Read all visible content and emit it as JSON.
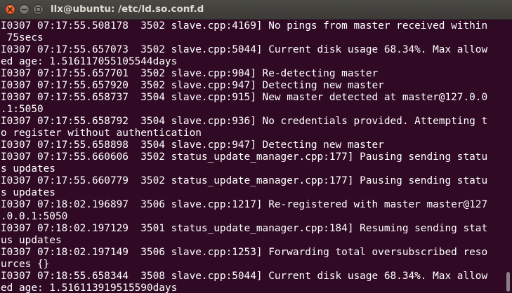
{
  "window": {
    "title": "llx@ubuntu: /etc/ld.so.conf.d",
    "controls": {
      "close_icon": "close-icon",
      "minimize_icon": "minimize-icon",
      "maximize_icon": "maximize-icon"
    }
  },
  "colors": {
    "terminal_bg": "#300a24",
    "terminal_fg": "#ffffff",
    "titlebar": "#3c3b37",
    "close_button": "#e0531f"
  },
  "terminal": {
    "lines": [
      "I0307 07:17:55.508178  3502 slave.cpp:4169] No pings from master received within",
      " 75secs",
      "I0307 07:17:55.657073  3502 slave.cpp:5044] Current disk usage 68.34%. Max allow",
      "ed age: 1.516117055105544days",
      "I0307 07:17:55.657701  3502 slave.cpp:904] Re-detecting master",
      "I0307 07:17:55.657920  3502 slave.cpp:947] Detecting new master",
      "I0307 07:17:55.658737  3504 slave.cpp:915] New master detected at master@127.0.0",
      ".1:5050",
      "I0307 07:17:55.658792  3504 slave.cpp:936] No credentials provided. Attempting t",
      "o register without authentication",
      "I0307 07:17:55.658898  3504 slave.cpp:947] Detecting new master",
      "I0307 07:17:55.660606  3502 status_update_manager.cpp:177] Pausing sending statu",
      "s updates",
      "I0307 07:17:55.660779  3502 status_update_manager.cpp:177] Pausing sending statu",
      "s updates",
      "I0307 07:18:02.196897  3506 slave.cpp:1217] Re-registered with master master@127",
      ".0.0.1:5050",
      "I0307 07:18:02.197129  3501 status_update_manager.cpp:184] Resuming sending stat",
      "us updates",
      "I0307 07:18:02.197149  3506 slave.cpp:1253] Forwarding total oversubscribed reso",
      "urces {}",
      "I0307 07:18:55.658344  3508 slave.cpp:5044] Current disk usage 68.34%. Max allow",
      "ed age: 1.516113919515590days"
    ]
  }
}
